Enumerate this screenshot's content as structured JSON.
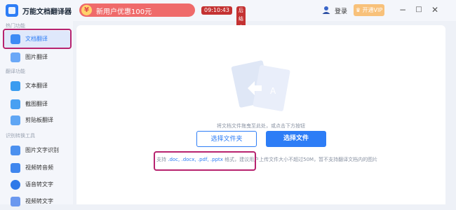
{
  "app": {
    "title": "万能文档翻译器",
    "logo_icon": "app-logo-icon"
  },
  "promo": {
    "icon_text": "¥",
    "text": "新用户优惠100元",
    "timer": "09:10:43",
    "tag": "后结束"
  },
  "header": {
    "login_label": "登录",
    "vip_label": "开通VIP",
    "window_controls": [
      "−",
      "□",
      "✕"
    ]
  },
  "sidebar": {
    "sections": [
      {
        "label": "热门功能",
        "items": [
          {
            "label": "文档翻译",
            "icon": "document-icon",
            "active": true
          },
          {
            "label": "图片翻译",
            "icon": "image-icon",
            "active": false
          }
        ]
      },
      {
        "label": "翻译功能",
        "items": [
          {
            "label": "文本翻译",
            "icon": "text-icon",
            "active": false
          },
          {
            "label": "截图翻译",
            "icon": "screenshot-icon",
            "active": false
          },
          {
            "label": "剪贴板翻译",
            "icon": "clipboard-icon",
            "active": false
          }
        ]
      },
      {
        "label": "识别转换工具",
        "items": [
          {
            "label": "图片文字识别",
            "icon": "ocr-icon",
            "active": false
          },
          {
            "label": "视频转音频",
            "icon": "video-icon",
            "active": false
          },
          {
            "label": "语音转文字",
            "icon": "voice-icon",
            "active": false
          },
          {
            "label": "视频转文字",
            "icon": "audio-icon",
            "active": false
          }
        ]
      }
    ]
  },
  "main": {
    "drop_hint": "将文档文件拖曳至此处，或点击下方按钮",
    "select_folder_label": "选择文件夹",
    "select_file_label": "选择文件",
    "support_prefix": "支持",
    "support_formats": ".doc, .docx, .pdf, .pptx",
    "support_suffix": "格式，建议用户上传文件大小不超过50M，暂不支持翻译文档内的图片"
  },
  "colors": {
    "accent": "#2d7df6",
    "highlight": "#b7236f",
    "promo": "#ef6a6a"
  }
}
